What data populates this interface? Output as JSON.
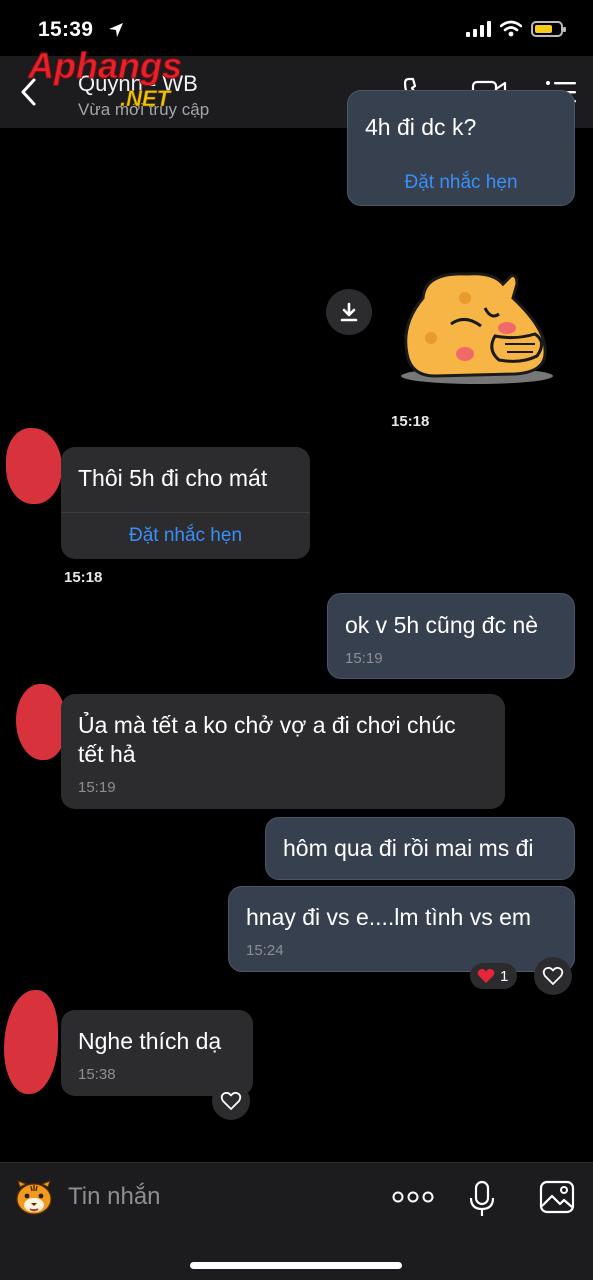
{
  "status_bar": {
    "time": "15:39"
  },
  "header": {
    "contact_name": "Quynh - WB",
    "contact_status": "Vừa mới truy cập",
    "watermark": "Aphangs.NET"
  },
  "messages": {
    "top_partial_text": "4h đi dc k?",
    "top_remind": "Đặt nhắc hẹn",
    "sticker_time": "15:18",
    "m1_text": "Thôi 5h đi cho mát",
    "m1_remind": "Đặt nhắc hẹn",
    "m1_time": "15:18",
    "m2_text": "ok v 5h cũng đc nè",
    "m2_time": "15:19",
    "m3_text_line1": "Ủa mà tết a ko chở vợ a đi chơi chúc",
    "m3_text_line2": "tết hả",
    "m3_time": "15:19",
    "m4_text": "hôm qua đi rồi mai ms đi",
    "m5_text": "hnay đi vs e....lm tình vs em",
    "m5_time": "15:24",
    "m5_reaction_count": "1",
    "m6_text": "Nghe thích dạ",
    "m6_time": "15:38"
  },
  "composer": {
    "placeholder": "Tin nhắn"
  },
  "icons": {
    "back": "chevron-left-icon",
    "call": "phone-icon",
    "video": "video-camera-icon",
    "menu": "list-menu-icon",
    "download": "download-icon",
    "heart": "heart-icon",
    "sticker": "tiger-sticker-icon",
    "more": "more-dots-icon",
    "mic": "microphone-icon",
    "gallery": "image-icon"
  },
  "colors": {
    "accent": "#3a8ff7",
    "battery": "#f5cc1a",
    "reaction_heart": "#e8243b"
  }
}
